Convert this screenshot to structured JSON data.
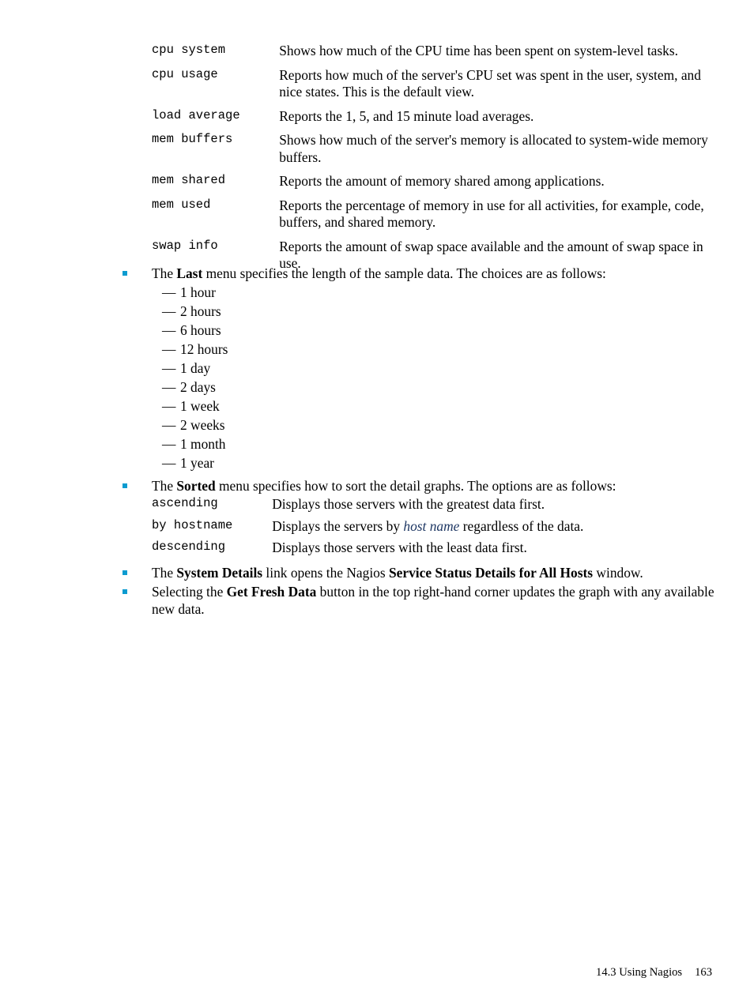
{
  "metrics_table": {
    "rows": [
      {
        "term": "cpu system",
        "desc": "Shows how much of the CPU time has been spent on system-level tasks."
      },
      {
        "term": "cpu usage",
        "desc": "Reports how much of the server's CPU set was spent in the user, system, and nice states. This is the default view."
      },
      {
        "term": "load average",
        "desc": "Reports the 1, 5, and 15 minute load averages."
      },
      {
        "term": "mem buffers",
        "desc": "Shows how much of the server's memory is allocated to system-wide memory buffers."
      },
      {
        "term": "mem shared",
        "desc": "Reports the amount of memory shared among applications."
      },
      {
        "term": "mem used",
        "desc": "Reports the percentage of memory in use for all activities, for example, code, buffers, and shared memory."
      },
      {
        "term": "swap info",
        "desc": "Reports the amount of swap space available and the amount of swap space in use."
      }
    ]
  },
  "bullets": {
    "last_menu": {
      "prefix": "The ",
      "bold": "Last",
      "suffix": " menu specifies the length of the sample data. The choices are as follows:",
      "options": [
        "1 hour",
        "2 hours",
        "6 hours",
        "12 hours",
        "1 day",
        "2 days",
        "1 week",
        "2 weeks",
        "1 month",
        "1 year"
      ],
      "dash": "—"
    },
    "sorted_menu": {
      "prefix": "The ",
      "bold": "Sorted",
      "suffix": " menu specifies how to sort the detail graphs. The options are as follows:"
    },
    "system_details": {
      "part1": "The ",
      "bold1": "System Details",
      "part2": " link opens the Nagios ",
      "bold2": "Service Status Details for All Hosts",
      "part3": " window."
    },
    "get_fresh_data": {
      "part1": "Selecting the ",
      "bold1": "Get Fresh Data",
      "part2": " button in the top right-hand corner updates the graph with any available new data."
    }
  },
  "sorted_table": {
    "rows": [
      {
        "term": "ascending",
        "desc_before": "Displays those servers with the greatest data first.",
        "xref": "",
        "desc_after": ""
      },
      {
        "term": "by hostname",
        "desc_before": "Displays the servers by ",
        "xref": "host name",
        "desc_after": " regardless of the data."
      },
      {
        "term": "descending",
        "desc_before": "Displays those servers with the least data first.",
        "xref": "",
        "desc_after": ""
      }
    ]
  },
  "footer": {
    "section": "14.3 Using Nagios",
    "page_number": "163"
  },
  "colors": {
    "bullet": "#0c9bd0",
    "xref": "#1f3864",
    "text": "#000000"
  }
}
